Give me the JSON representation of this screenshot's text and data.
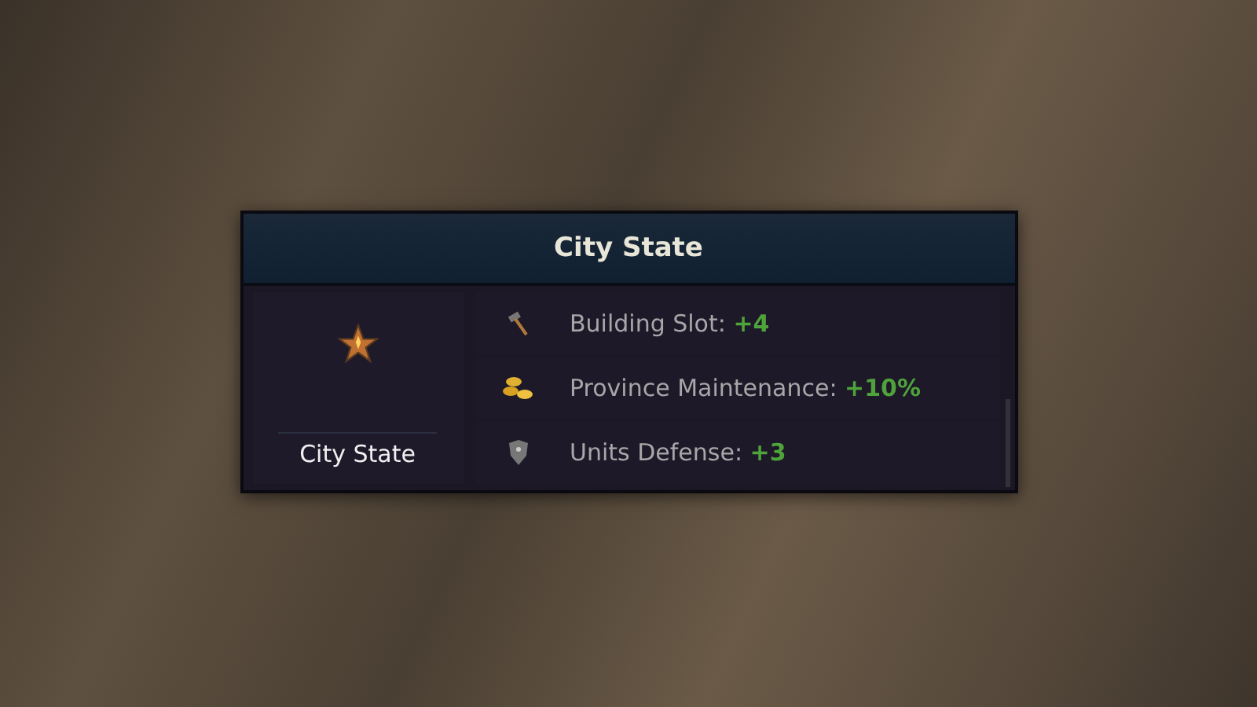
{
  "panel": {
    "title": "City State",
    "type_label": "City State",
    "effects": [
      {
        "kind": "hammer",
        "label": "Building Slot:",
        "value": "+4"
      },
      {
        "kind": "coins",
        "label": "Province Maintenance:",
        "value": "+10%"
      },
      {
        "kind": "shield",
        "label": "Units Defense:",
        "value": "+3"
      }
    ]
  }
}
